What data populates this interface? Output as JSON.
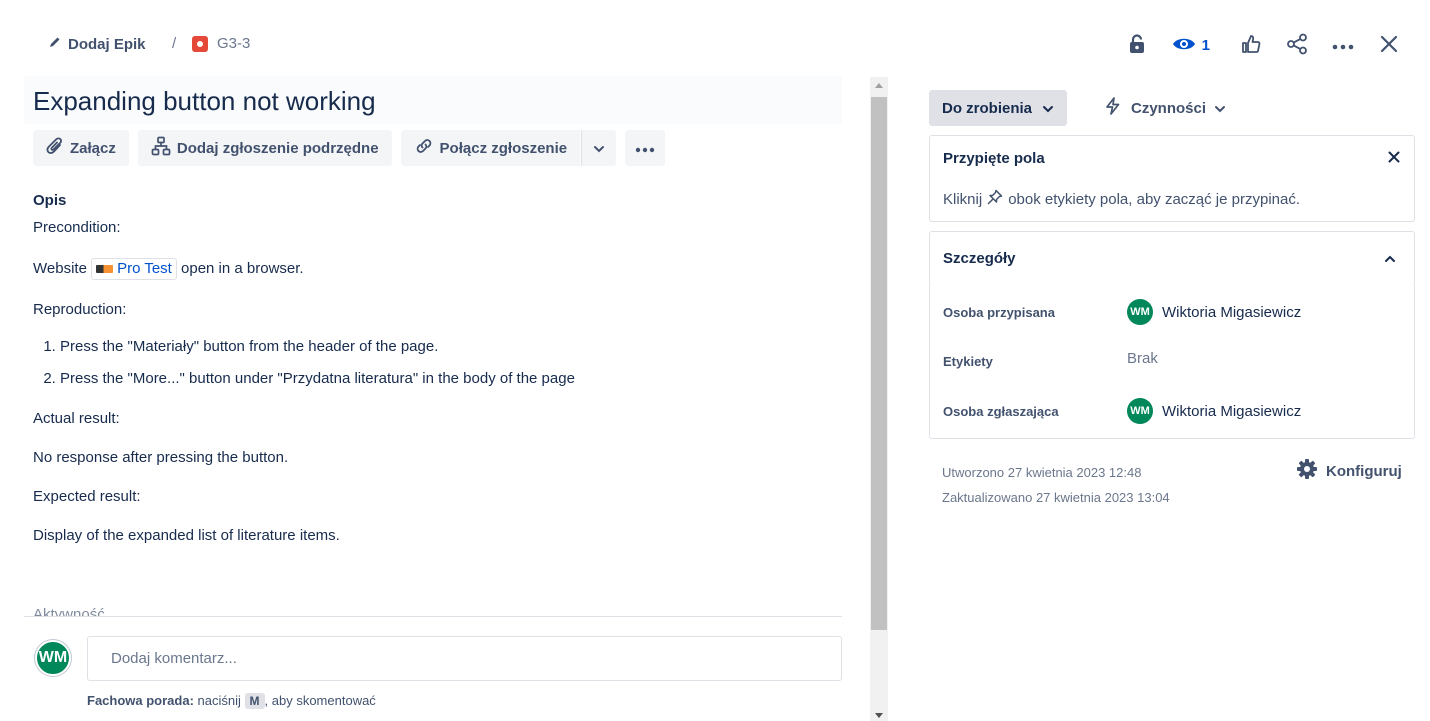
{
  "breadcrumb": {
    "epic_label": "Dodaj Epik",
    "separator": "/",
    "issue_key": "G3-3"
  },
  "toolbar": {
    "watch_count": "1",
    "icons": [
      "lock-icon",
      "eye-icon",
      "like-icon",
      "share-icon",
      "more-icon",
      "close-icon"
    ]
  },
  "issue": {
    "title": "Expanding button not working",
    "actions": {
      "attach": "Załącz",
      "add_child": "Dodaj zgłoszenie podrzędne",
      "link_issue": "Połącz zgłoszenie"
    },
    "description": {
      "heading": "Opis",
      "precondition_label": "Precondition:",
      "website_prefix": "Website",
      "website_chip": "Pro Test",
      "website_suffix": "open in a browser.",
      "reproduction_label": "Reproduction:",
      "steps": [
        "Press the \"Materiały\" button from the header of the page.",
        "Press the \"More...\" button under \"Przydatna literatura\" in the body of the page"
      ],
      "actual_label": "Actual result:",
      "actual_text": "No response after pressing the button.",
      "expected_label": "Expected result:",
      "expected_text": "Display of the expanded list of literature items."
    },
    "activity_label": "Aktywność"
  },
  "comment": {
    "avatar_initials": "WM",
    "placeholder": "Dodaj komentarz...",
    "tip_bold": "Fachowa porada:",
    "tip_pre": "naciśnij",
    "tip_key": "M",
    "tip_post": ", aby skomentować"
  },
  "sidebar": {
    "status": "Do zrobienia",
    "actions": "Czynności",
    "pinned": {
      "title": "Przypięte pola",
      "text_pre": "Kliknij",
      "text_post": "obok etykiety pola, aby zacząć je przypinać."
    },
    "details": {
      "title": "Szczegóły",
      "rows": [
        {
          "label": "Osoba przypisana",
          "value": "Wiktoria Migasiewicz",
          "initials": "WM"
        },
        {
          "label": "Etykiety",
          "value": "Brak"
        },
        {
          "label": "Osoba zgłaszająca",
          "value": "Wiktoria Migasiewicz",
          "initials": "WM"
        }
      ]
    },
    "created": "Utworzono 27 kwietnia 2023 12:48",
    "updated": "Zaktualizowano 27 kwietnia 2023 13:04",
    "configure": "Konfiguruj"
  },
  "colors": {
    "accent": "#0052cc",
    "avatar": "#00875a",
    "bug": "#e5493a"
  }
}
